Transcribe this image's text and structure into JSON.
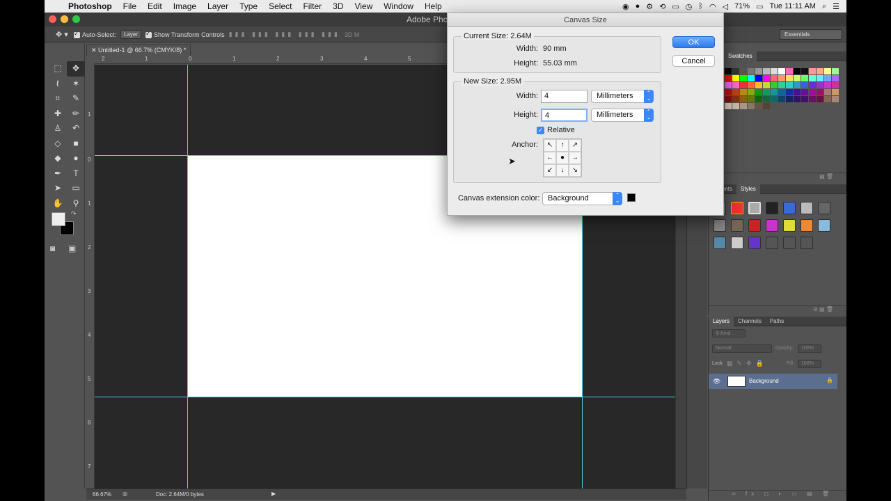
{
  "menubar": {
    "app_name": "Photoshop",
    "items": [
      "File",
      "Edit",
      "Image",
      "Layer",
      "Type",
      "Select",
      "Filter",
      "3D",
      "View",
      "Window",
      "Help"
    ],
    "battery": "71%",
    "clock": "Tue 11:11 AM"
  },
  "window": {
    "title": "Adobe Photo"
  },
  "options_bar": {
    "auto_select_label": "Auto-Select:",
    "auto_select_value": "Layer",
    "transform_label": "Show Transform Controls",
    "mode_3d": "3D M",
    "workspace": "Essentials"
  },
  "document": {
    "tab_title": "Untitled-1 @ 66.7% (CMYK/8) *",
    "zoom": "66.67%",
    "doc_info": "Doc: 2.64M/0 bytes"
  },
  "rulers": {
    "top": [
      "2",
      "1",
      "0",
      "1",
      "2",
      "3",
      "4",
      "5"
    ],
    "left": [
      "1",
      "0",
      "1",
      "2",
      "3",
      "4",
      "5",
      "6",
      "7"
    ]
  },
  "panels": {
    "swatches_tab": "Swatches",
    "adjustments_tab": "stments",
    "styles_tab": "Styles",
    "layers_tab": "Layers",
    "channels_tab": "Channels",
    "paths_tab": "Paths",
    "kind_filter": "Kind",
    "blend_mode": "Normal",
    "opacity_label": "Opacity:",
    "opacity_value": "100%",
    "lock_label": "Lock:",
    "fill_label": "Fill:",
    "fill_value": "100%",
    "background_layer": "Background"
  },
  "dialog": {
    "title": "Canvas Size",
    "current_size_label": "Current Size: 2.64M",
    "current_width_label": "Width:",
    "current_width_value": "90 mm",
    "current_height_label": "Height:",
    "current_height_value": "55.03 mm",
    "new_size_label": "New Size: 2.95M",
    "width_label": "Width:",
    "width_value": "4",
    "width_unit": "Millimeters",
    "height_label": "Height:",
    "height_value": "4",
    "height_unit": "Millimeters",
    "relative_label": "Relative",
    "relative_checked": true,
    "anchor_label": "Anchor:",
    "anchor_arrows": [
      "↖",
      "↑",
      "↗",
      "←",
      "●",
      "→",
      "↙",
      "↓",
      "↘"
    ],
    "extension_label": "Canvas extension color:",
    "extension_value": "Background",
    "ok_label": "OK",
    "cancel_label": "Cancel"
  },
  "colors": {
    "accent": "#3d86f7",
    "guide": "#4fd1e6",
    "foreground": "#eeeeee",
    "background": "#000000"
  }
}
